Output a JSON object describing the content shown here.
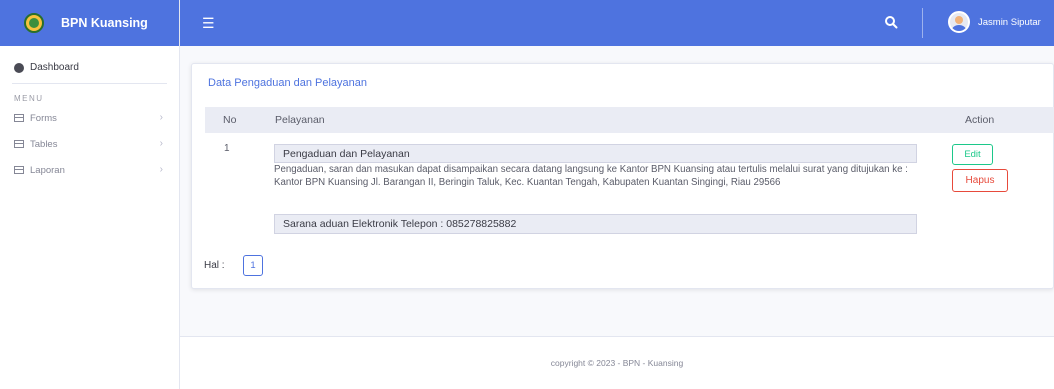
{
  "brand": {
    "name": "BPN Kuansing"
  },
  "sidebar": {
    "dashboard_label": "Dashboard",
    "menu_heading": "MENU",
    "items": [
      {
        "label": "Forms"
      },
      {
        "label": "Tables"
      },
      {
        "label": "Laporan"
      }
    ]
  },
  "topbar": {
    "user_name": "Jasmin Siputar"
  },
  "card": {
    "title": "Data Pengaduan dan Pelayanan",
    "columns": {
      "no": "No",
      "pelayanan": "Pelayanan",
      "action": "Action"
    },
    "rows": [
      {
        "no": "1",
        "heading": "Pengaduan dan Pelayanan",
        "description": "Pengaduan, saran dan masukan dapat disampaikan secara datang langsung ke Kantor BPN Kuansing atau tertulis melalui surat yang ditujukan ke : Kantor BPN Kuansing Jl. Barangan II, Beringin Taluk, Kec. Kuantan Tengah, Kabupaten Kuantan Singingi, Riau 29566",
        "contact": "Sarana aduan Elektronik Telepon : 085278825882",
        "edit_label": "Edit",
        "delete_label": "Hapus"
      }
    ],
    "pagination": {
      "label": "Hal :",
      "current_page": "1"
    }
  },
  "footer": {
    "text": "copyright © 2023 - BPN - Kuansing"
  },
  "colors": {
    "primary": "#4e73df",
    "success": "#1cc88a",
    "danger": "#e74a3b"
  }
}
